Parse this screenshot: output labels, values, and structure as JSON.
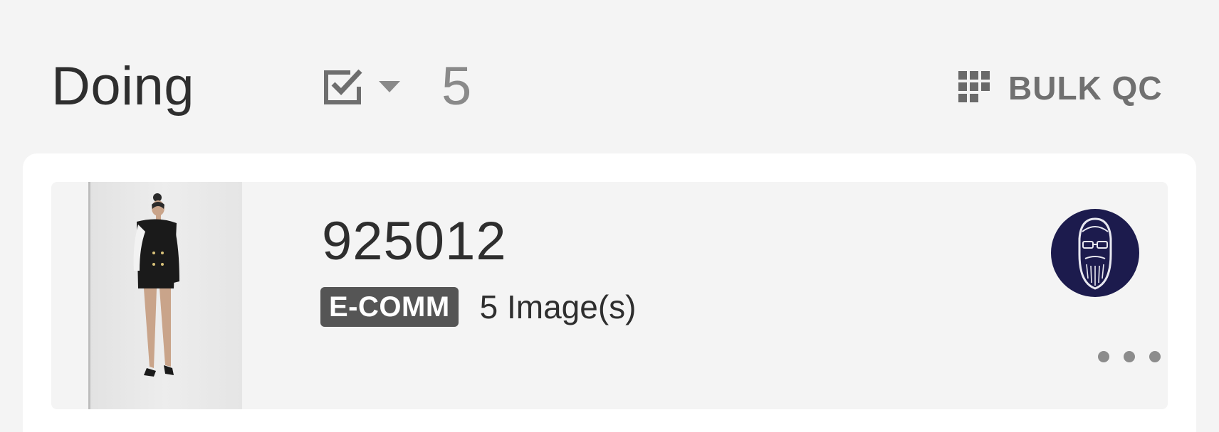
{
  "column": {
    "title": "Doing",
    "count": "5",
    "bulk_qc_label": "BULK QC",
    "icons": {
      "select": "checkbox-icon",
      "caret": "caret-down-icon",
      "bulk": "grid-icon"
    }
  },
  "cards": [
    {
      "job_id": "925012",
      "tag": "E-COMM",
      "image_count": "5 Image(s)",
      "thumbnail": "product-photo",
      "assignee": "avatar",
      "menu": "more-icon"
    }
  ],
  "colors": {
    "background": "#f4f4f4",
    "tag_bg": "#555555",
    "avatar_bg": "#1c1b4d",
    "muted": "#8a8a8a"
  }
}
